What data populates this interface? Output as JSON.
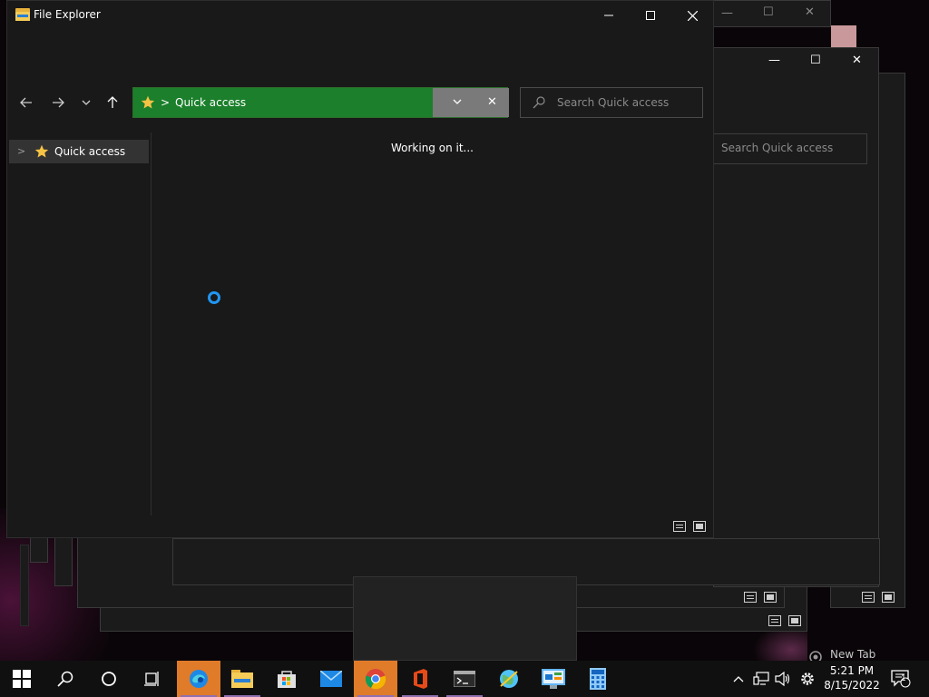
{
  "window": {
    "title": "File Explorer",
    "minimize_icon": "minimize-icon",
    "maximize_icon": "maximize-icon",
    "close_icon": "close-icon"
  },
  "toolbar": {
    "back_icon": "arrow-left-icon",
    "forward_icon": "arrow-right-icon",
    "recent_icon": "chevron-down-icon",
    "up_icon": "arrow-up-icon"
  },
  "address": {
    "location_icon": "star-icon",
    "separator": ">",
    "path": "Quick access",
    "dropdown_icon": "chevron-down-icon",
    "clear_icon": "close-icon",
    "accent": "#1b7f2b"
  },
  "search": {
    "placeholder": "Search Quick access"
  },
  "nav_pane": {
    "items": [
      {
        "label": "Quick access",
        "icon": "star-icon",
        "expander": ">"
      }
    ]
  },
  "content": {
    "status": "Working on it...",
    "spinner_color": "#2196f3"
  },
  "background_window": {
    "search_placeholder": "Search Quick access"
  },
  "taskbar": {
    "apps": [
      {
        "name": "start",
        "icon": "windows-logo-icon"
      },
      {
        "name": "search",
        "icon": "search-icon"
      },
      {
        "name": "cortana",
        "icon": "cortana-circle-icon"
      },
      {
        "name": "task-view",
        "icon": "task-view-icon"
      },
      {
        "name": "edge",
        "icon": "edge-icon",
        "active": true
      },
      {
        "name": "file-explorer",
        "icon": "folder-icon"
      },
      {
        "name": "store",
        "icon": "store-icon"
      },
      {
        "name": "mail",
        "icon": "mail-icon"
      },
      {
        "name": "chrome",
        "icon": "chrome-icon",
        "active": true
      },
      {
        "name": "office",
        "icon": "office-icon"
      },
      {
        "name": "terminal",
        "icon": "terminal-icon"
      },
      {
        "name": "maps",
        "icon": "globe-icon"
      },
      {
        "name": "control-panel",
        "icon": "control-panel-icon"
      },
      {
        "name": "calculator",
        "icon": "calculator-icon"
      }
    ],
    "clock_time": "5:21 PM",
    "clock_date": "8/15/2022",
    "notification_count": "1",
    "hover_preview_label": "New Tab"
  }
}
